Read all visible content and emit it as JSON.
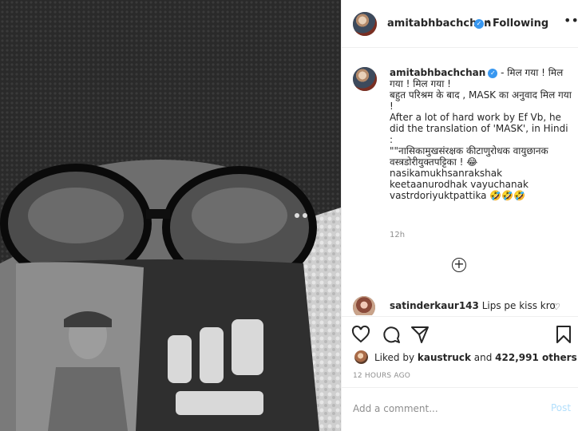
{
  "post": {
    "author": {
      "username": "amitabhbachchan",
      "verified_icon": "verified-badge-icon"
    },
    "header": {
      "separator": "•",
      "follow_label": "Following",
      "more_icon": "more-options-icon"
    },
    "caption": {
      "username": "amitabhbachchan",
      "lines": [
        " - मिल गया ! मिल गया ! मिल गया !",
        "बहुत परिश्रम के बाद , MASK का अनुवाद मिल गया !",
        "After a lot of hard work by Ef Vb, he did the translation of 'MASK', in Hindi :",
        "\"\"नासिकामुखसंरक्षक कीटाणुरोधक वायुछानक वस्त्रडोरीयुक्तपट्टिका ! 😂",
        "nasikamukhsanrakshak keetaanurodhak vayuchanak vastrdoriyuktpattika 🤣🤣🤣"
      ],
      "time_ago": "12h"
    },
    "load_more_icon": "plus-circle-icon",
    "comment": {
      "username": "satinderkaur143",
      "text": " Lips pe kiss kro",
      "like_icon": "heart-small-icon"
    },
    "actions": {
      "like_icon": "heart-icon",
      "comment_icon": "comment-icon",
      "share_icon": "share-icon",
      "save_icon": "bookmark-icon"
    },
    "likes": {
      "prefix": "Liked by ",
      "liker": "kaustruck",
      "middle": " and ",
      "count": "422,991 others"
    },
    "posted_ago": "12 HOURS AGO",
    "add_comment": {
      "placeholder": "Add a comment...",
      "post_label": "Post"
    },
    "colors": {
      "verified": "#3897f0",
      "post_button_disabled": "#b2dffc",
      "muted_text": "#8e8e8e",
      "divider": "#efefef"
    }
  }
}
